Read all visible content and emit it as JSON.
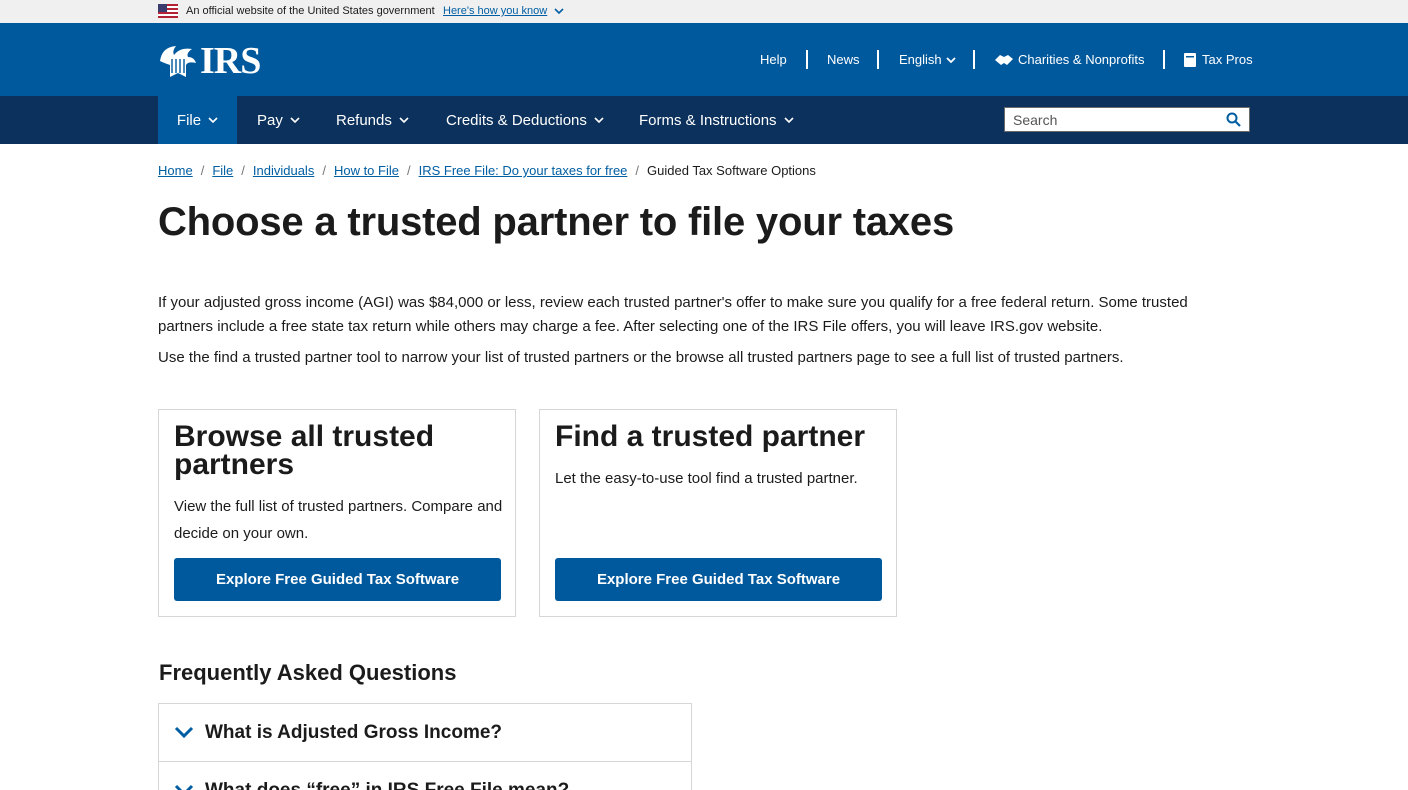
{
  "gov_banner": {
    "official_text": "An official website of the United States government",
    "how_you_know": "Here's how you know"
  },
  "header": {
    "logo_text": "IRS",
    "links": {
      "help": "Help",
      "news": "News",
      "language": "English",
      "charities": "Charities & Nonprofits",
      "tax_pros": "Tax Pros"
    }
  },
  "nav": {
    "items": [
      "File",
      "Pay",
      "Refunds",
      "Credits & Deductions",
      "Forms & Instructions"
    ],
    "search_placeholder": "Search"
  },
  "breadcrumb": {
    "items": [
      "Home",
      "File",
      "Individuals",
      "How to File",
      "IRS Free File: Do your taxes for free"
    ],
    "current": "Guided Tax Software Options"
  },
  "page": {
    "title": "Choose a trusted partner to file your taxes",
    "intro": "If your adjusted gross income (AGI) was $84,000 or less, review each trusted partner's offer to make sure you qualify for a free federal return. Some trusted partners include a free state tax return while others may charge a fee. After selecting one of the IRS File offers, you will leave IRS.gov website.",
    "intro2": "Use the find a trusted partner tool to narrow your list of trusted partners or the browse all trusted partners page to see a full list of trusted partners."
  },
  "cards": [
    {
      "title": "Browse all trusted partners",
      "text": "View the full list of trusted partners. Compare and decide on your own.",
      "button": "Explore Free Guided Tax Software"
    },
    {
      "title": "Find a trusted partner",
      "text": "Let the easy-to-use tool find a trusted partner.",
      "button": "Explore Free Guided Tax Software"
    }
  ],
  "faq": {
    "title": "Frequently Asked Questions",
    "questions": [
      "What is Adjusted Gross Income?",
      "What does “free” in IRS Free File mean?"
    ]
  },
  "colors": {
    "header_blue": "#00599c",
    "nav_dark": "#0b315c",
    "link": "#005ea2"
  },
  "icons": [
    "us-flag-icon",
    "chevron-down-icon",
    "irs-eagle-icon",
    "handshake-icon",
    "book-icon",
    "search-icon"
  ]
}
